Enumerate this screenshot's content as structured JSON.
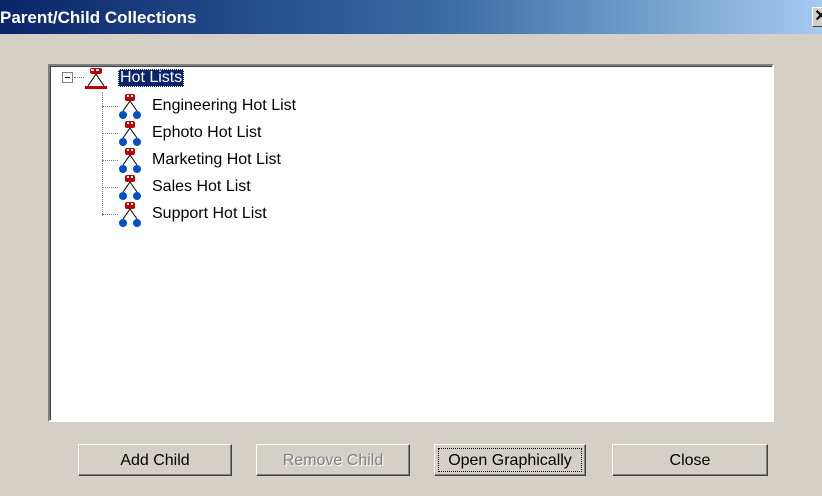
{
  "window": {
    "title": "Parent/Child Collections",
    "close_glyph": "✕"
  },
  "tree": {
    "root": {
      "label": "Hot Lists",
      "icon": "collection-root-icon",
      "selected": true,
      "expanded": true
    },
    "children": [
      {
        "label": "Engineering Hot List",
        "icon": "collection-icon"
      },
      {
        "label": "Ephoto Hot List",
        "icon": "collection-icon"
      },
      {
        "label": "Marketing Hot List",
        "icon": "collection-icon"
      },
      {
        "label": "Sales Hot List",
        "icon": "collection-icon"
      },
      {
        "label": "Support Hot List",
        "icon": "collection-icon"
      }
    ]
  },
  "buttons": {
    "add_child": "Add Child",
    "remove_child": "Remove Child",
    "open_graphically": "Open Graphically",
    "close": "Close"
  },
  "colors": {
    "selection": "#0a246a",
    "face": "#d4d0c8",
    "title_start": "#0a246a",
    "title_end": "#a6caf0",
    "icon_red": "#c00000",
    "icon_blue": "#0050c8"
  }
}
